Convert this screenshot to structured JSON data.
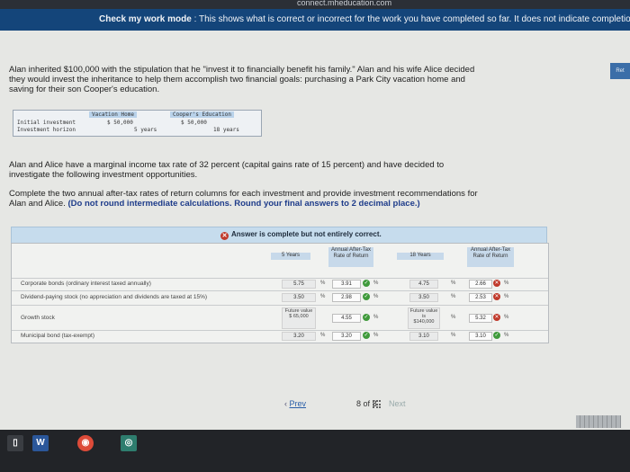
{
  "topbar": {
    "fragment": "connect.mheducation.com"
  },
  "banner": {
    "prefix": "Check my work mode",
    "text": " : This shows what is correct or incorrect for the work you have completed so far. It does not indicate completion."
  },
  "side_tab": {
    "label": "Ret"
  },
  "problem": {
    "intro": "Alan inherited $100,000 with the stipulation that he \"invest it to financially benefit his family.\" Alan and his wife Alice decided they would invest the inheritance to help them accomplish two financial goals: purchasing a Park City vacation home and saving for their son Cooper's education.",
    "table": {
      "col1": "Vacation Home",
      "col2": "Cooper's Education",
      "row1_label": "Initial investment",
      "row2_label": "Investment horizon",
      "vac_invest": "$ 50,000",
      "vac_horizon": "5 years",
      "edu_invest": "$ 50,000",
      "edu_horizon": "18 years"
    },
    "tax": "Alan and Alice have a marginal income tax rate of 32 percent (capital gains rate of 15 percent) and have decided to investigate the following investment opportunities.",
    "instruction": "Complete the two annual after-tax rates of return columns for each investment and provide investment recommendations for Alan and Alice.",
    "instruction_bold": "(Do not round intermediate calculations. Round your final answers to 2 decimal place.)"
  },
  "answer": {
    "status": "Answer is complete but not entirely correct."
  },
  "grid": {
    "headers": {
      "five_years": "5 Years",
      "after_tax_5": "Annual After-Tax Rate of Return",
      "eighteen_years": "18 Years",
      "after_tax_18": "Annual After-Tax Rate of Return"
    },
    "pct_symbol": "%",
    "rows": [
      {
        "label": "Corporate bonds (ordinary interest taxed annually)",
        "y5": "5.75",
        "at5": "3.91",
        "at5_ok": true,
        "y18": "4.75",
        "at18": "2.66",
        "at18_ok": false
      },
      {
        "label": "Dividend-paying stock (no appreciation and dividends are taxed at 15%)",
        "y5": "3.50",
        "at5": "2.98",
        "at5_ok": true,
        "y18": "3.50",
        "at18": "2.53",
        "at18_ok": false
      },
      {
        "label": "Growth stock",
        "fv5_label": "Future value",
        "fv5_value": "$ 65,000",
        "at5": "4.55",
        "at5_ok": true,
        "fv18_label": "Future value is",
        "fv18_value": "$140,000",
        "at18": "5.32",
        "at18_ok": false
      },
      {
        "label": "Municipal bond (tax-exempt)",
        "y5": "3.20",
        "at5": "3.20",
        "at5_ok": true,
        "y18": "3.10",
        "at18": "3.10",
        "at18_ok": true
      }
    ]
  },
  "pager": {
    "prev": "Prev",
    "current": "8",
    "of": "of",
    "total": "8",
    "next": "Next"
  },
  "taskbar": {
    "word": "W"
  }
}
